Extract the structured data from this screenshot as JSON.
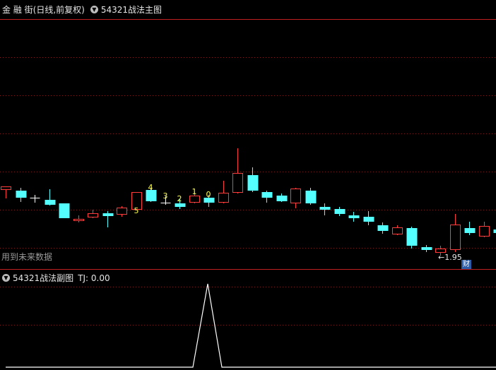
{
  "main": {
    "title_stock": "金 融 街",
    "title_mode": "(日线,前复权)",
    "title_indicator": "54321战法主图",
    "dropdown_icon": "chevron-down-icon",
    "warning": "用到未来数据",
    "price_marker": "←1.95",
    "badge": "财",
    "markers": [
      {
        "label": "5",
        "index": 9
      },
      {
        "label": "4",
        "index": 10
      },
      {
        "label": "3",
        "index": 11
      },
      {
        "label": "2",
        "index": 12
      },
      {
        "label": "1",
        "index": 13
      },
      {
        "label": "0",
        "index": 14
      }
    ],
    "candles": [
      {
        "o": 268,
        "c": 264,
        "h": 264,
        "l": 281
      },
      {
        "o": 270,
        "c": 280,
        "h": 266,
        "l": 286
      },
      {
        "o": 280,
        "c": 280,
        "h": 276,
        "l": 287
      },
      {
        "o": 283,
        "c": 290,
        "h": 268,
        "l": 291
      },
      {
        "o": 288,
        "c": 309,
        "h": 288,
        "l": 309
      },
      {
        "o": 312,
        "c": 310,
        "h": 305,
        "l": 315
      },
      {
        "o": 307,
        "c": 302,
        "h": 297,
        "l": 309
      },
      {
        "o": 302,
        "c": 306,
        "h": 299,
        "l": 322
      },
      {
        "o": 303,
        "c": 294,
        "h": 292,
        "l": 307
      },
      {
        "o": 296,
        "c": 272,
        "h": 272,
        "l": 298
      },
      {
        "o": 269,
        "c": 285,
        "h": 266,
        "l": 286
      },
      {
        "o": 287,
        "c": 287,
        "h": 278,
        "l": 290
      },
      {
        "o": 288,
        "c": 293,
        "h": 282,
        "l": 296
      },
      {
        "o": 286,
        "c": 277,
        "h": 272,
        "l": 288
      },
      {
        "o": 280,
        "c": 287,
        "h": 276,
        "l": 293
      },
      {
        "o": 286,
        "c": 273,
        "h": 256,
        "l": 288
      },
      {
        "o": 272,
        "c": 245,
        "h": 210,
        "l": 274
      },
      {
        "o": 248,
        "c": 270,
        "h": 237,
        "l": 272
      },
      {
        "o": 272,
        "c": 280,
        "h": 270,
        "l": 287
      },
      {
        "o": 277,
        "c": 285,
        "h": 274,
        "l": 286
      },
      {
        "o": 287,
        "c": 267,
        "h": 266,
        "l": 295
      },
      {
        "o": 270,
        "c": 288,
        "h": 266,
        "l": 290
      },
      {
        "o": 293,
        "c": 297,
        "h": 288,
        "l": 305
      },
      {
        "o": 296,
        "c": 303,
        "h": 293,
        "l": 306
      },
      {
        "o": 305,
        "c": 309,
        "h": 300,
        "l": 314
      },
      {
        "o": 307,
        "c": 314,
        "h": 299,
        "l": 319
      },
      {
        "o": 319,
        "c": 327,
        "h": 315,
        "l": 331
      },
      {
        "o": 331,
        "c": 322,
        "h": 319,
        "l": 333
      },
      {
        "o": 323,
        "c": 348,
        "h": 321,
        "l": 352
      },
      {
        "o": 350,
        "c": 354,
        "h": 347,
        "l": 357
      },
      {
        "o": 357,
        "c": 352,
        "h": 348,
        "l": 362
      },
      {
        "o": 353,
        "c": 318,
        "h": 303,
        "l": 357
      },
      {
        "o": 323,
        "c": 330,
        "h": 314,
        "l": 333
      },
      {
        "o": 334,
        "c": 320,
        "h": 314,
        "l": 336
      },
      {
        "o": 325,
        "c": 330,
        "h": 321,
        "l": 332
      }
    ],
    "colors": {
      "up": "#ff3c3c",
      "down": "#54ffff",
      "grid": "#8a1a1a",
      "marker": "#ffff50",
      "flat": "#ffffff"
    }
  },
  "sub": {
    "title_indicator": "54321战法副图",
    "tj_label": "TJ: 0.00",
    "line_color": "#ffffff"
  }
}
